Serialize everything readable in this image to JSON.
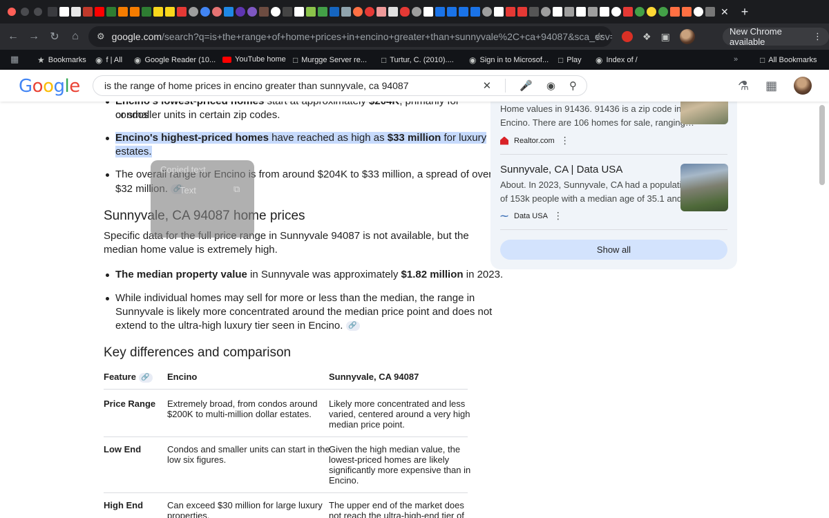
{
  "browser": {
    "tab_new": "+",
    "tab_close": "✕",
    "url_host": "google.com",
    "url_path": "/search?q=is+the+range+of+home+prices+in+encino+greater+than+sunnyvale%2C+ca+94087&sca_esv=be80...",
    "new_chrome_label": "New Chrome available",
    "bookmarks": [
      {
        "label": "Bookmarks",
        "icon": "star-icon"
      },
      {
        "label": "f | All",
        "icon": "globe-icon"
      },
      {
        "label": "Google Reader (10...",
        "icon": "globe-icon"
      },
      {
        "label": "YouTube home",
        "icon": "youtube-icon"
      },
      {
        "label": "Murgge Server re...",
        "icon": "folder-icon"
      },
      {
        "label": "Turtur, C. (2010)....",
        "icon": "folder-icon"
      },
      {
        "label": "Sign in to Microsof...",
        "icon": "globe-icon"
      },
      {
        "label": "Play",
        "icon": "folder-icon"
      },
      {
        "label": "Index of /",
        "icon": "globe-icon"
      },
      {
        "label": "All Bookmarks",
        "icon": "folder-icon"
      }
    ]
  },
  "search": {
    "query": "is the range of home prices in encino greater than sunnyvale, ca 94087",
    "logo": "Google"
  },
  "content": {
    "b1_strong": "Encino's lowest-priced homes",
    "b1_rest_a": " start at approximately ",
    "b1_strong2": "$204K",
    "b1_rest_b": ", primarily for condos",
    "b1_line2": "or smaller units in certain zip codes.",
    "b2_strong": "Encino's highest-priced homes",
    "b2_rest_a": " have reached as high as ",
    "b2_strong2": "$33 million",
    "b2_rest_b": " for luxury",
    "b2_line2": "estates.",
    "b3_line1": "The overall range for Encino is from around $204K to $33 million, a spread of over",
    "b3_line2": "$32 million.",
    "popup_item1": "Copied text",
    "popup_item2": "Text",
    "h_sunnyvale": "Sunnyvale, CA 94087 home prices",
    "p_sunny_line1": "Specific data for the full price range in Sunnyvale 94087 is not available, but the",
    "p_sunny_line2": "median home value is extremely high.",
    "b4_strong": "The median property value",
    "b4_rest_a": " in Sunnyvale was approximately ",
    "b4_strong2": "$1.82 million",
    "b4_rest_b": " in 2023.",
    "b5_line1": "While individual homes may sell for more or less than the median, the range in",
    "b5_line2": "Sunnyvale is likely more concentrated around the median price point and does not",
    "b5_line3": "extend to the ultra-high luxury tier seen in Encino.",
    "h_key": "Key differences and comparison"
  },
  "table": {
    "headers": [
      "Feature",
      "Encino",
      "Sunnyvale, CA 94087"
    ],
    "rows": [
      {
        "feature": "Price Range",
        "encino": [
          "Extremely broad, from condos around",
          "$200K to multi-million dollar estates."
        ],
        "sunnyvale": [
          "Likely more concentrated and less",
          "varied, centered around a very high",
          "median price point."
        ]
      },
      {
        "feature": "Low End",
        "encino": [
          "Condos and smaller units can start in the",
          "low six figures."
        ],
        "sunnyvale": [
          "Given the high median value, the",
          "lowest-priced homes are likely",
          "significantly more expensive than in",
          "Encino."
        ]
      },
      {
        "feature": "High End",
        "encino": [
          "Can exceed $30 million for large luxury",
          "properties."
        ],
        "sunnyvale": [
          "The upper end of the market does",
          "not reach the ultra-high-end tier of"
        ]
      }
    ]
  },
  "panel": {
    "card1_line1": "Home values in 91436. 91436 is a zip code in",
    "card1_line2": "Encino. There are 106 homes for sale, ranging…",
    "card1_source": "Realtor.com",
    "card2_title": "Sunnyvale, CA | Data USA",
    "card2_line1": "About. In 2023, Sunnyvale, CA had a population",
    "card2_line2": "of 153k people with a median age of 35.1 and a…",
    "card2_source": "Data USA",
    "more_menu": "⋮",
    "show_all": "Show all"
  },
  "colors": {
    "highlight": "#c6dafc",
    "show_all_bg": "#d3e3fd",
    "panel_bg": "#f0f4f9"
  }
}
